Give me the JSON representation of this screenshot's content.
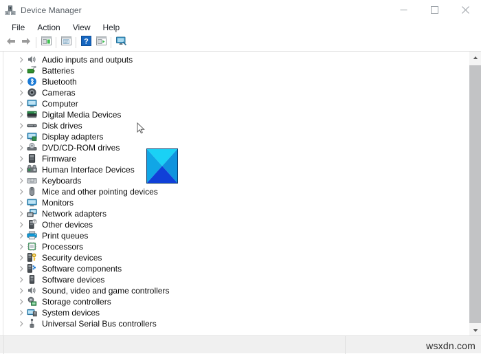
{
  "window": {
    "title": "Device Manager",
    "icon": "device-manager-icon",
    "controls": {
      "minimize": "–",
      "maximize": "☐",
      "close": "✕"
    }
  },
  "menubar": {
    "items": [
      {
        "label": "File"
      },
      {
        "label": "Action"
      },
      {
        "label": "View"
      },
      {
        "label": "Help"
      }
    ]
  },
  "toolbar": {
    "buttons": [
      {
        "name": "back-button",
        "icon": "left-arrow-icon"
      },
      {
        "name": "forward-button",
        "icon": "right-arrow-icon"
      },
      {
        "name": "properties-button",
        "icon": "properties-panel-icon"
      },
      {
        "name": "update-driver-button",
        "icon": "update-driver-icon"
      },
      {
        "name": "help-button",
        "icon": "question-mark-icon"
      },
      {
        "name": "scan-hardware-button",
        "icon": "scan-panel-icon"
      },
      {
        "name": "show-hidden-devices-button",
        "icon": "monitor-icon"
      }
    ]
  },
  "tree": {
    "items": [
      {
        "label": "Audio inputs and outputs",
        "icon": "speaker-icon"
      },
      {
        "label": "Batteries",
        "icon": "battery-icon"
      },
      {
        "label": "Bluetooth",
        "icon": "bluetooth-icon"
      },
      {
        "label": "Cameras",
        "icon": "camera-icon"
      },
      {
        "label": "Computer",
        "icon": "computer-icon"
      },
      {
        "label": "Digital Media Devices",
        "icon": "media-device-icon"
      },
      {
        "label": "Disk drives",
        "icon": "disk-drive-icon"
      },
      {
        "label": "Display adapters",
        "icon": "display-adapter-icon"
      },
      {
        "label": "DVD/CD-ROM drives",
        "icon": "optical-drive-icon"
      },
      {
        "label": "Firmware",
        "icon": "firmware-icon"
      },
      {
        "label": "Human Interface Devices",
        "icon": "hid-icon"
      },
      {
        "label": "Keyboards",
        "icon": "keyboard-icon"
      },
      {
        "label": "Mice and other pointing devices",
        "icon": "mouse-icon"
      },
      {
        "label": "Monitors",
        "icon": "monitor-icon"
      },
      {
        "label": "Network adapters",
        "icon": "network-adapter-icon"
      },
      {
        "label": "Other devices",
        "icon": "other-device-icon"
      },
      {
        "label": "Print queues",
        "icon": "printer-icon"
      },
      {
        "label": "Processors",
        "icon": "processor-icon"
      },
      {
        "label": "Security devices",
        "icon": "security-device-icon"
      },
      {
        "label": "Software components",
        "icon": "software-component-icon"
      },
      {
        "label": "Software devices",
        "icon": "software-device-icon"
      },
      {
        "label": "Sound, video and game controllers",
        "icon": "speaker-icon"
      },
      {
        "label": "Storage controllers",
        "icon": "storage-controller-icon"
      },
      {
        "label": "System devices",
        "icon": "system-device-icon"
      },
      {
        "label": "Universal Serial Bus controllers",
        "icon": "usb-icon"
      }
    ],
    "expander_state": "collapsed"
  },
  "scrollbar": {
    "up_arrow": "scroll-up-icon",
    "down_arrow": "scroll-down-icon",
    "orientation": "vertical"
  },
  "overlay": {
    "shape": "diagonal-split-square",
    "colors": {
      "top": "#1ad1f5",
      "left": "#0fa8e8",
      "right": "#0f9ae0",
      "bottom": "#1040d8",
      "border": "#0a3a6b"
    }
  },
  "statusbar": {
    "text": "",
    "watermark": "wsxdn.com"
  },
  "colors": {
    "window_bg": "#ffffff",
    "text": "#0b0b0b",
    "title_text": "#555c63",
    "scrollbar_thumb": "#c2c3c5",
    "statusbar_bg": "#f0f0f0"
  }
}
